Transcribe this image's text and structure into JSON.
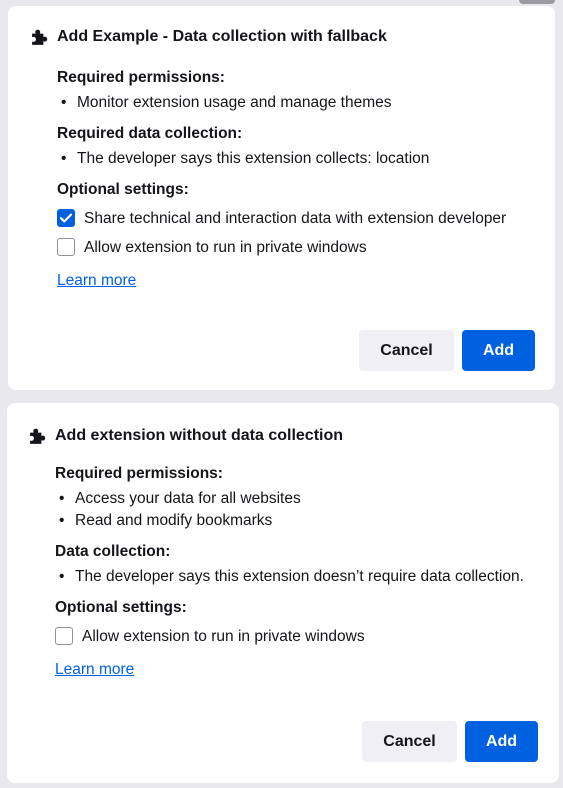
{
  "colors": {
    "accent": "#0061e0",
    "background": "#e9e9ed",
    "text": "#15141a",
    "button_secondary": "#f0f0f4"
  },
  "dialogs": [
    {
      "icon": "puzzle-piece-icon",
      "title": "Add Example - Data collection with fallback",
      "sections": [
        {
          "heading": "Required permissions:",
          "items": [
            "Monitor extension usage and manage themes"
          ]
        },
        {
          "heading": "Required data collection:",
          "items": [
            "The developer says this extension collects: location"
          ]
        }
      ],
      "optional_heading": "Optional settings:",
      "options": [
        {
          "label": "Share technical and interaction data with extension developer",
          "checked": true
        },
        {
          "label": "Allow extension to run in private windows",
          "checked": false
        }
      ],
      "learn_more": "Learn more",
      "cancel_label": "Cancel",
      "add_label": "Add"
    },
    {
      "icon": "puzzle-piece-icon",
      "title": "Add extension without data collection",
      "sections": [
        {
          "heading": "Required permissions:",
          "items": [
            "Access your data for all websites",
            "Read and modify bookmarks"
          ]
        },
        {
          "heading": "Data collection:",
          "items": [
            "The developer says this extension doesn’t require data collection."
          ]
        }
      ],
      "optional_heading": "Optional settings:",
      "options": [
        {
          "label": "Allow extension to run in private windows",
          "checked": false
        }
      ],
      "learn_more": "Learn more",
      "cancel_label": "Cancel",
      "add_label": "Add"
    }
  ]
}
